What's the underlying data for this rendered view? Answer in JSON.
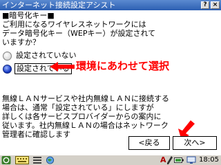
{
  "window": {
    "title": "インターネット接続設定アシスト",
    "help_glyph": "?",
    "close_glyph": "×"
  },
  "content": {
    "heading": "■暗号化キー■",
    "question": "ご利用になるワイヤレスネットワークには\nデータ暗号化キー（WEPキー）が設定されて\nいますか？",
    "options": [
      {
        "label": "設定されていない",
        "selected": false
      },
      {
        "label": "設定されている",
        "selected": true
      }
    ],
    "note": "無線ＬＡＮサービスや社内無線ＬＡＮに接続する\n場合は、通常「設定されている」にしますが\n詳しくは各サービスプロバイダーからの案内に\n従います。社内無線ＬＡＮの場合はネットワーク\n管理者に確認します"
  },
  "annotation": {
    "text": "環境にあわせて選択",
    "color": "#ff0000"
  },
  "buttons": {
    "back": "<戻る",
    "next": "次へ>"
  },
  "taskbar": {
    "icons": [
      "start-icon",
      "keyboard-icon",
      "list-icon",
      "globe-icon",
      "input-mode-icon",
      "network-icon",
      "battery-icon"
    ],
    "input_mode": "A",
    "time": "18:05"
  },
  "colors": {
    "titlebar": "#2c5fb2",
    "annotation": "#ff0000"
  }
}
